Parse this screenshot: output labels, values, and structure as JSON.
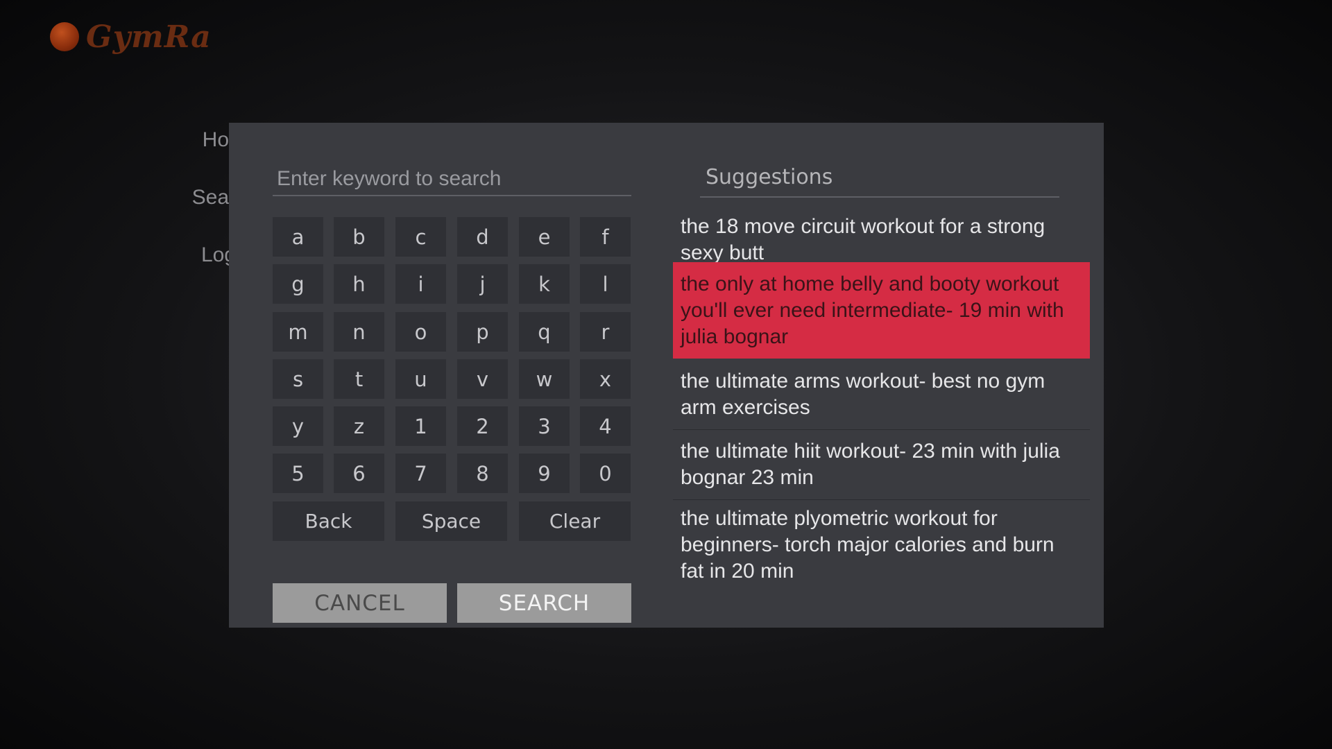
{
  "app": {
    "logo_text": "GymRa"
  },
  "side_menu": {
    "items": [
      {
        "label": "Hor"
      },
      {
        "label": "Sear"
      },
      {
        "label": "Log"
      }
    ]
  },
  "search_dialog": {
    "input": {
      "value": "",
      "placeholder": "Enter keyword to search"
    },
    "keyboard": {
      "keys": [
        "a",
        "b",
        "c",
        "d",
        "e",
        "f",
        "g",
        "h",
        "i",
        "j",
        "k",
        "l",
        "m",
        "n",
        "o",
        "p",
        "q",
        "r",
        "s",
        "t",
        "u",
        "v",
        "w",
        "x",
        "y",
        "z",
        "1",
        "2",
        "3",
        "4",
        "5",
        "6",
        "7",
        "8",
        "9",
        "0"
      ],
      "back_label": "Back",
      "space_label": "Space",
      "clear_label": "Clear"
    },
    "cancel_label": "CANCEL",
    "search_label": "SEARCH",
    "suggestions": {
      "title": "Suggestions",
      "items": [
        {
          "text": "the 18 move circuit workout for a strong sexy butt",
          "selected": false
        },
        {
          "text": "the only at home belly and booty workout you'll ever need intermediate- 19 min with julia bognar",
          "selected": true
        },
        {
          "text": "the ultimate arms workout- best no gym arm exercises",
          "selected": false
        },
        {
          "text": "the ultimate hiit workout- 23 min with julia bognar 23 min",
          "selected": false
        },
        {
          "text": "the ultimate plyometric workout for beginners- torch major calories and burn fat in 20 min",
          "selected": false
        }
      ]
    }
  },
  "colors": {
    "dialog_bg": "#3a3b40",
    "key_bg": "#2f3035",
    "selected_suggestion": "#d52c44",
    "action_button_bg": "#9b9b9b"
  }
}
